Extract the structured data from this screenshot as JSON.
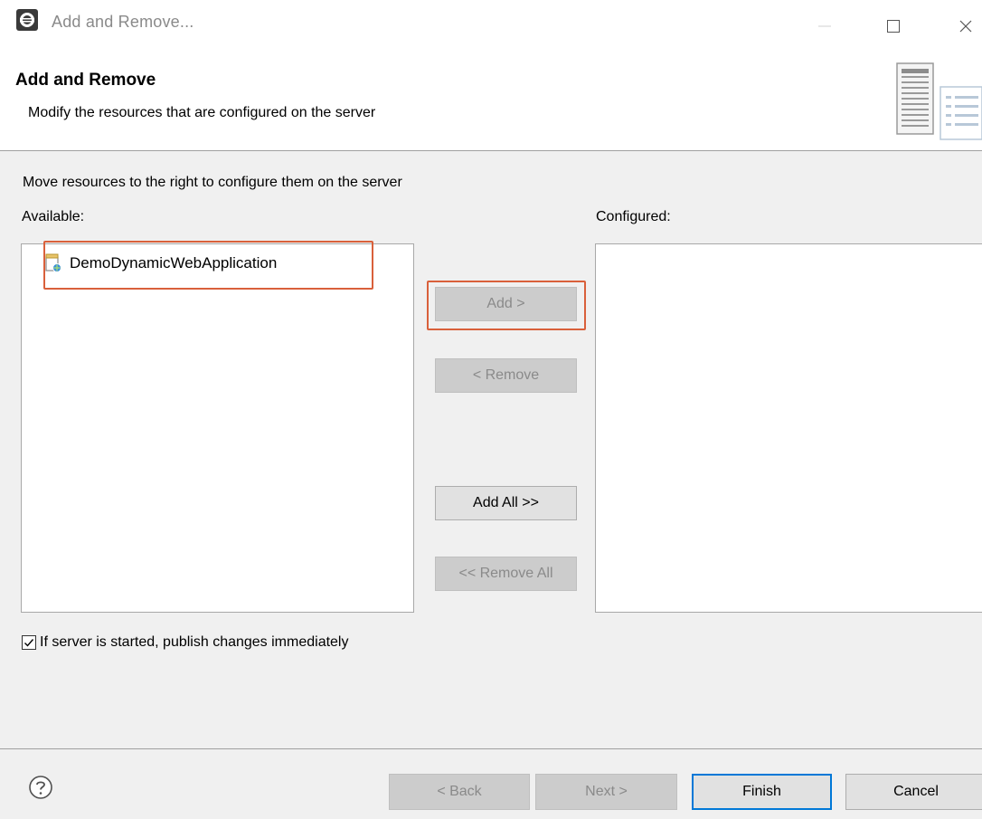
{
  "window": {
    "title": "Add and Remove..."
  },
  "banner": {
    "title": "Add and Remove",
    "description": "Modify the resources that are configured on the server"
  },
  "body": {
    "instruction": "Move resources to the right to configure them on the server",
    "available_label": "Available:",
    "configured_label": "Configured:",
    "available_items": [
      {
        "label": "DemoDynamicWebApplication",
        "icon": "web-project-icon"
      }
    ],
    "configured_items": []
  },
  "buttons": {
    "add": "Add >",
    "remove": "< Remove",
    "add_all": "Add All >>",
    "remove_all": "<< Remove All"
  },
  "publish_checkbox": {
    "label": "If server is started, publish changes immediately",
    "checked": true
  },
  "footer": {
    "back": "< Back",
    "next": "Next >",
    "finish": "Finish",
    "cancel": "Cancel"
  },
  "colors": {
    "highlight": "#d9603b",
    "default_button_border": "#0078d7",
    "disabled_text": "#8a8a8a"
  }
}
